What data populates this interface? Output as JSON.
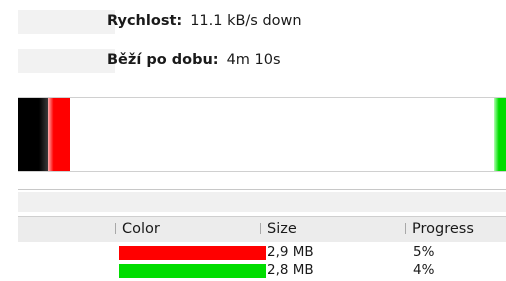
{
  "info": {
    "speed_label": "Rychlost:",
    "speed_value": "11.1 kB/s down",
    "elapsed_label": "Běží po dobu:",
    "elapsed_value": "4m 10s"
  },
  "graph": {
    "colors": [
      "#000000",
      "#ff0000",
      "#00dd00"
    ]
  },
  "list": {
    "columns": [
      "Color",
      "Size",
      "Progress"
    ],
    "rows": [
      {
        "color": "#ff0000",
        "size": "2,9 MB",
        "progress": "5%"
      },
      {
        "color": "#00dd00",
        "size": "2,8 MB",
        "progress": "4%"
      }
    ]
  }
}
